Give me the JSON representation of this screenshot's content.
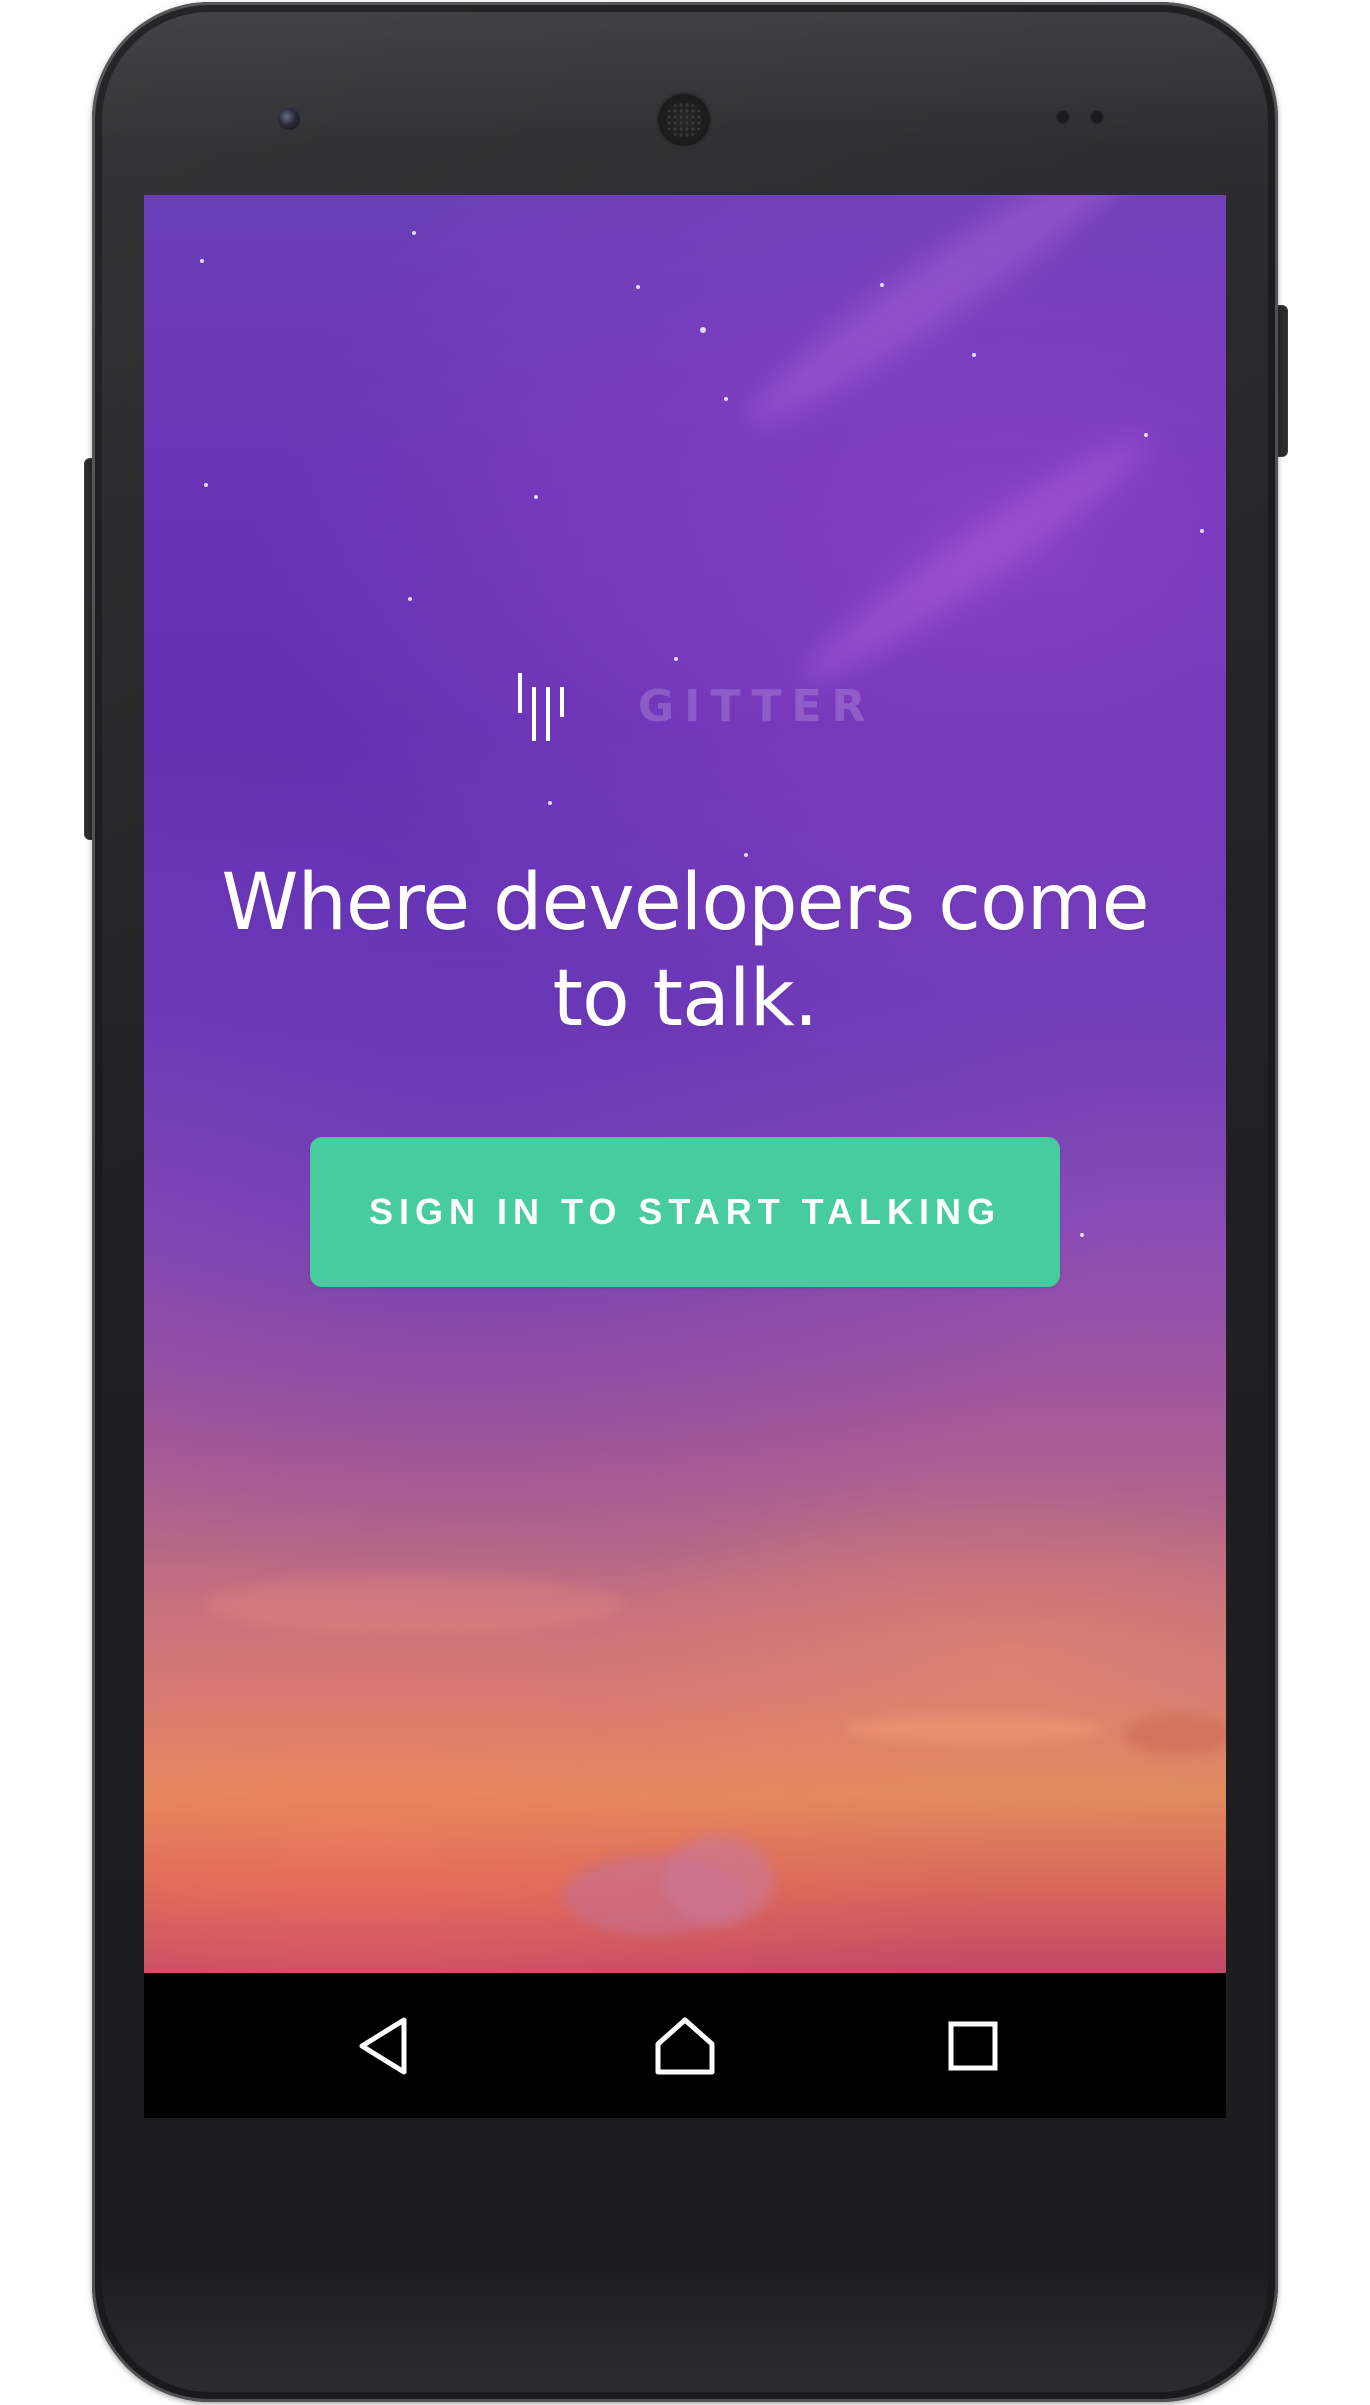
{
  "app": {
    "name": "GITTER",
    "tagline": "Where developers come to talk.",
    "cta_label": "SIGN IN TO START TALKING"
  },
  "colors": {
    "cta_background": "#46cc9f",
    "cta_text": "#ffffff",
    "headline_text": "#ffffff",
    "wallpaper_top": "#6a3fb6",
    "wallpaper_bottom": "#c24868",
    "navbar_background": "#000000"
  },
  "navigation_bar": {
    "back_icon": "triangle-back-icon",
    "home_icon": "house-home-icon",
    "recents_icon": "square-recents-icon"
  }
}
